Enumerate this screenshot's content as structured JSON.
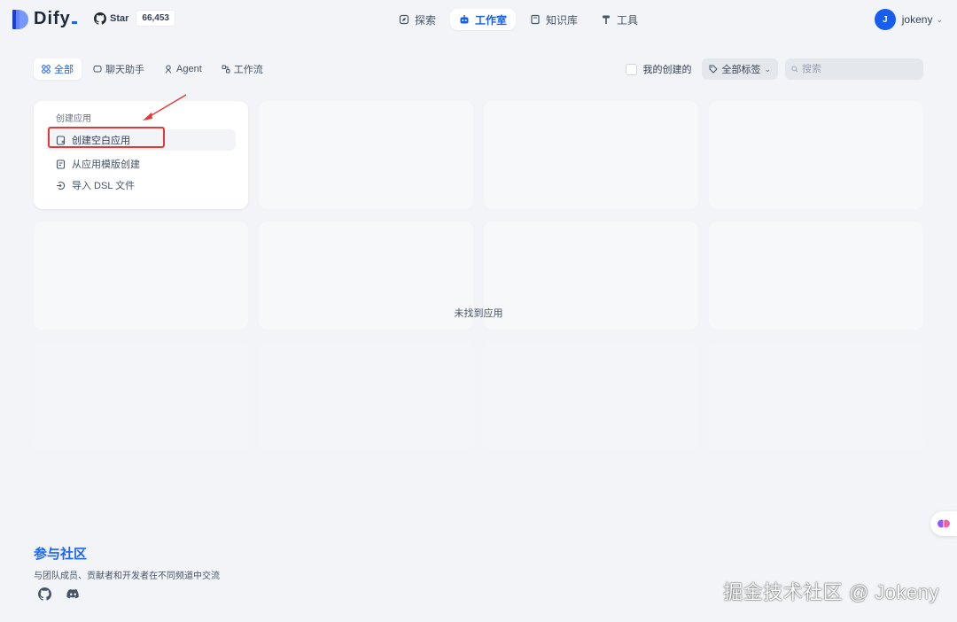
{
  "header": {
    "logo_text": "Dify",
    "github_label": "Star",
    "star_count": "66,453",
    "nav": [
      {
        "label": "探索",
        "icon": "compass-icon"
      },
      {
        "label": "工作室",
        "icon": "robot-icon",
        "active": true
      },
      {
        "label": "知识库",
        "icon": "book-icon"
      },
      {
        "label": "工具",
        "icon": "hammer-icon"
      }
    ],
    "user": {
      "avatar_letter": "J",
      "name": "jokeny"
    }
  },
  "filters": {
    "tabs": [
      {
        "label": "全部",
        "icon": "grid-icon",
        "active": true
      },
      {
        "label": "聊天助手",
        "icon": "chat-icon"
      },
      {
        "label": "Agent",
        "icon": "agent-icon"
      },
      {
        "label": "工作流",
        "icon": "workflow-icon"
      }
    ],
    "mine_label": "我的创建的",
    "tag_filter_label": "全部标签",
    "search_placeholder": "搜索"
  },
  "create_card": {
    "title": "创建应用",
    "items": [
      {
        "label": "创建空白应用",
        "icon": "file-plus-icon"
      },
      {
        "label": "从应用模版创建",
        "icon": "file-template-icon"
      },
      {
        "label": "导入 DSL 文件",
        "icon": "import-icon"
      }
    ]
  },
  "empty_text": "未找到应用",
  "community": {
    "title": "参与社区",
    "desc": "与团队成员、贡献者和开发者在不同频道中交流"
  },
  "watermark": "掘金技术社区 @ Jokeny",
  "colors": {
    "accent": "#155eef",
    "highlight": "#e53935",
    "background": "#f2f4f7"
  }
}
